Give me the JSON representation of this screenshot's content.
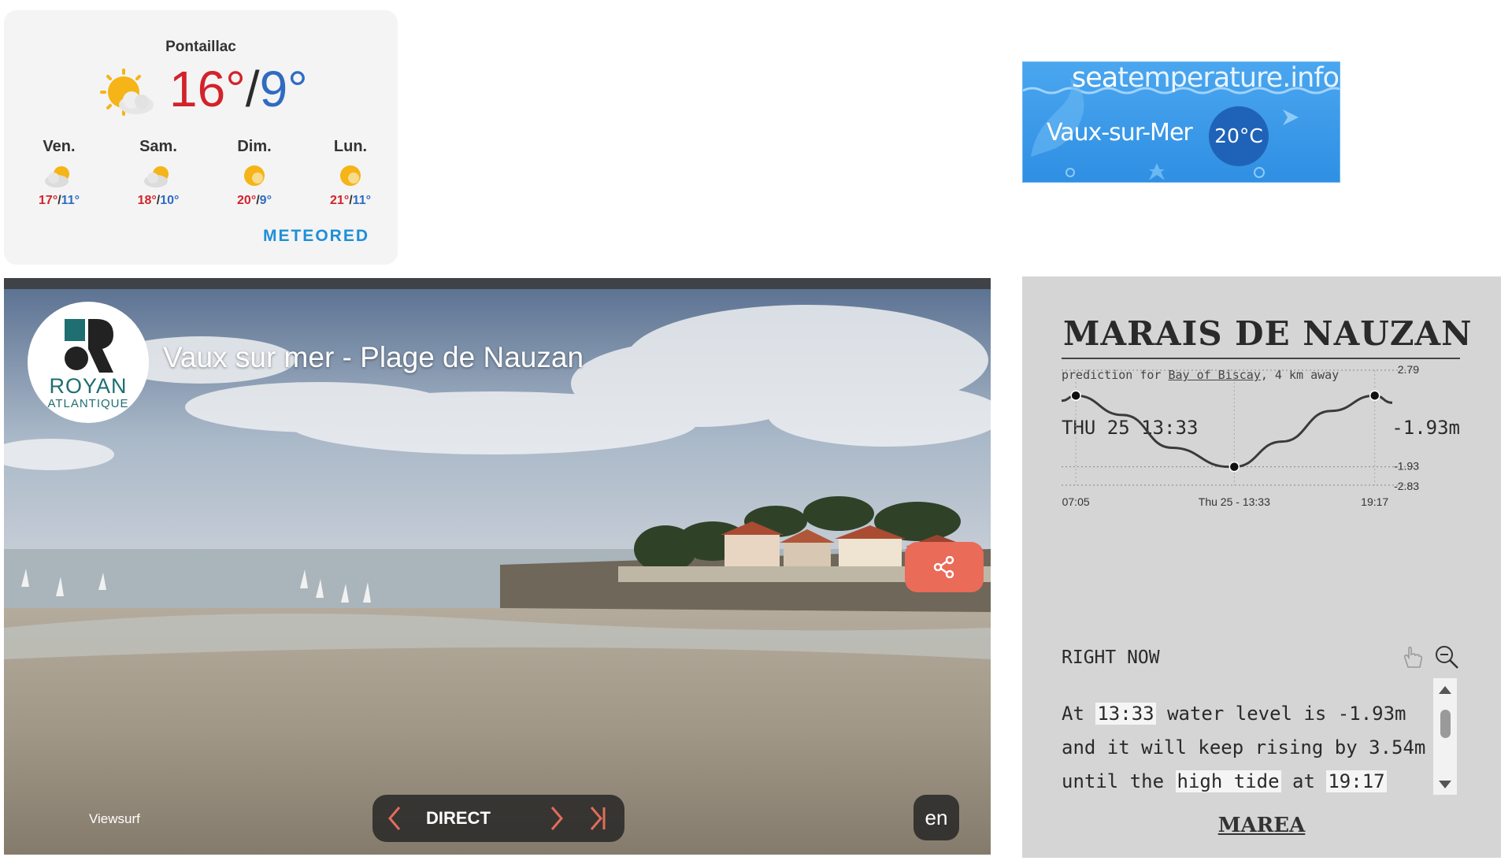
{
  "weather": {
    "location": "Pontaillac",
    "current": {
      "high": "16°",
      "separator": "/",
      "low": "9°",
      "icon": "sun-cloud-icon"
    },
    "forecast": [
      {
        "day": "Ven.",
        "high": "17°",
        "low": "11°",
        "icon": "partly-cloudy-icon"
      },
      {
        "day": "Sam.",
        "high": "18°",
        "low": "10°",
        "icon": "partly-cloudy-icon"
      },
      {
        "day": "Dim.",
        "high": "20°",
        "low": "9°",
        "icon": "sun-icon"
      },
      {
        "day": "Lun.",
        "high": "21°",
        "low": "11°",
        "icon": "sun-icon"
      }
    ],
    "temp_separator": "/",
    "brand": "METEORED"
  },
  "seatemp": {
    "site_bold": "sea",
    "site_rest": "temperature",
    "site_ext": ".info",
    "place": "Vaux-sur-Mer",
    "temperature": "20°C"
  },
  "webcam": {
    "logo_line1": "ROYAN",
    "logo_line2": "ATLANTIQUE",
    "title": "Vaux sur mer - Plage de Nauzan",
    "credit": "Viewsurf",
    "direct_label": "DIRECT",
    "language": "en",
    "share_icon": "share-icon"
  },
  "tide": {
    "station": "MARAIS DE NAUZAN",
    "prediction_prefix": "prediction for",
    "prediction_place": "Bay of Biscay",
    "prediction_suffix": ", 4 km away",
    "date": "THU 25  13:33",
    "level": "-1.93m",
    "right_now_label": "RIGHT NOW",
    "message": {
      "p1": "At",
      "time": "13:33",
      "p2": "water level is -1.93m and it will keep rising by 3.54m until the",
      "high_tide": "high tide",
      "p3": "at",
      "high_time": "19:17"
    },
    "brand": "MAREA",
    "accent_curve": "#3a3a3a"
  },
  "chart_data": {
    "type": "line",
    "title": "",
    "xlabel": "",
    "ylabel": "",
    "x_ticks": [
      "07:05",
      "Thu 25 - 13:33",
      "19:17"
    ],
    "y_ticks": [
      "2.79",
      "-1.93",
      "-2.83"
    ],
    "ylim": [
      -2.83,
      2.79
    ],
    "series": [
      {
        "x": [
          "06:30",
          "07:05",
          "09:00",
          "11:00",
          "13:20",
          "13:33",
          "15:30",
          "17:30",
          "19:17",
          "20:00"
        ],
        "values": [
          1.3,
          1.55,
          0.6,
          -1.0,
          -1.93,
          -1.93,
          -0.7,
          0.8,
          1.55,
          1.2
        ]
      }
    ],
    "markers": [
      {
        "x": "07:05",
        "y": 1.55
      },
      {
        "x": "13:33",
        "y": -1.93
      },
      {
        "x": "19:17",
        "y": 1.55
      }
    ]
  }
}
